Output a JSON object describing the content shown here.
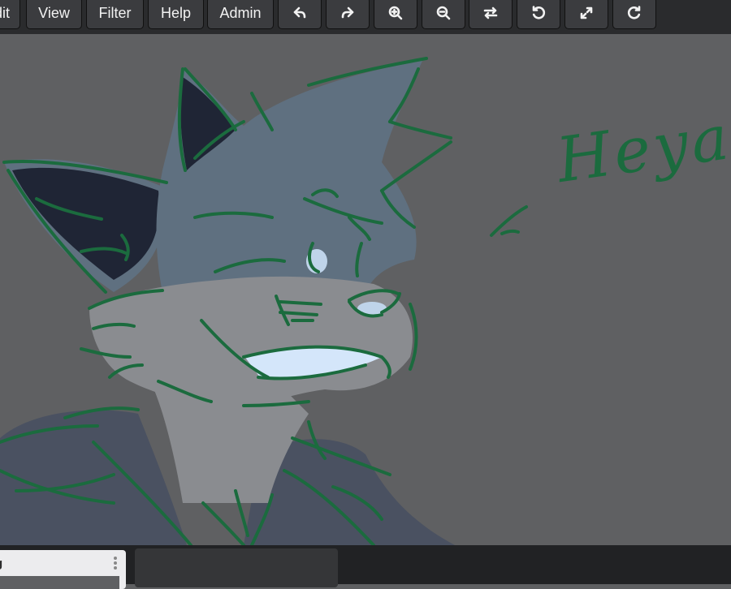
{
  "toolbar": {
    "edit_label": "Edit",
    "view_label": "View",
    "filter_label": "Filter",
    "help_label": "Help",
    "admin_label": "Admin",
    "icons": {
      "undo": "undo-icon",
      "redo": "redo-icon",
      "zoom_in": "zoom-in-icon",
      "zoom_out": "zoom-out-icon",
      "flip": "flip-horizontal-icon",
      "rotate_left": "rotate-left-icon",
      "fullscreen": "fullscreen-icon",
      "rotate_right": "rotate-right-icon"
    }
  },
  "canvas": {
    "drawing_text": "Heya!",
    "background_color": "#5f6062",
    "line_color": "#1b6b3e"
  },
  "bottom": {
    "layer_label": "g",
    "layer_menu_icon": "more-vertical-icon"
  }
}
